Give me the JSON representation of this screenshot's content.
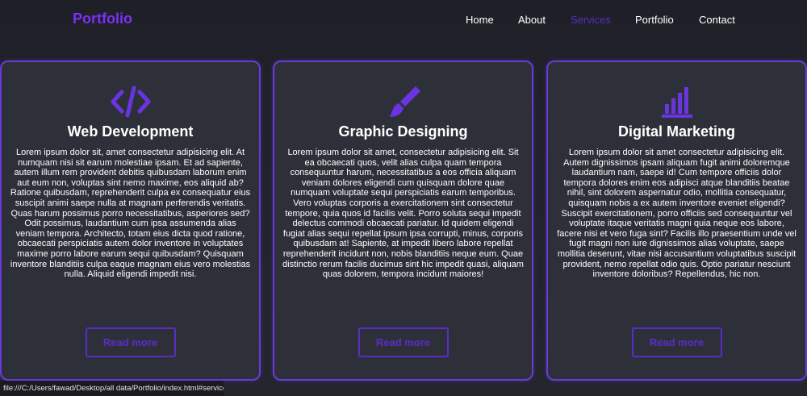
{
  "header": {
    "logo": "Portfolio",
    "nav": [
      "Home",
      "About",
      "Services",
      "Portfolio",
      "Contact"
    ],
    "active_nav": "Services"
  },
  "cards": [
    {
      "icon": "code-icon",
      "title": "Web Development",
      "text": "Lorem ipsum dolor sit, amet consectetur adipisicing elit. At numquam nisi sit earum molestiae ipsam. Et ad sapiente, autem illum rem provident debitis quibusdam laborum enim aut eum non, voluptas sint nemo maxime, eos aliquid ab? Ratione quibusdam, reprehenderit culpa ex consequatur eius suscipit animi saepe nulla at magnam perferendis veritatis. Quas harum possimus porro necessitatibus, asperiores sed? Odit possimus, laudantium cum ipsa assumenda alias veniam tempora. Architecto, totam eius dicta quod ratione, obcaecati perspiciatis autem dolor inventore in voluptates maxime porro labore earum sequi quibusdam? Quisquam inventore blanditiis culpa eaque magnam eius vero molestias nulla. Aliquid eligendi impedit nisi.",
      "button": "Read more"
    },
    {
      "icon": "paintbrush-icon",
      "title": "Graphic Designing",
      "text": "Lorem ipsum dolor sit amet, consectetur adipisicing elit. Sit ea obcaecati quos, velit alias culpa quam tempora consequuntur harum, necessitatibus a eos officia aliquam veniam dolores eligendi cum quisquam dolore quae numquam voluptate sequi perspiciatis earum temporibus. Vero voluptas corporis a exercitationem sint consectetur tempore, quia quos id facilis velit. Porro soluta sequi impedit delectus commodi obcaecati pariatur. Id quidem eligendi fugiat alias sequi repellat ipsum ipsa corrupti, minus, corporis quibusdam at! Sapiente, at impedit libero labore repellat reprehenderit incidunt non, nobis blanditiis neque eum. Quae distinctio rerum facilis ducimus sint hic impedit quasi, aliquam quas dolorem, tempora incidunt maiores!",
      "button": "Read more"
    },
    {
      "icon": "bar-chart-icon",
      "title": "Digital Marketing",
      "text": "Lorem ipsum dolor sit amet consectetur adipisicing elit. Autem dignissimos ipsam aliquam fugit animi doloremque laudantium nam, saepe id! Cum tempore officiis dolor tempora dolores enim eos adipisci atque blanditiis beatae nihil, sint dolorem aspernatur odio, mollitia consequatur, quisquam nobis a ex autem inventore eveniet eligendi? Suscipit exercitationem, porro officiis sed consequuntur vel voluptate itaque veritatis magni quia neque eos labore, facere nisi et vero fuga sint? Facilis illo praesentium unde vel fugit magni non iure dignissimos alias voluptate, saepe mollitia deserunt, vitae nisi accusantium voluptatibus suscipit provident, nemo repellat odio quis. Optio pariatur nesciunt inventore doloribus? Repellendus, hic non.",
      "button": "Read more"
    }
  ],
  "status_bar": {
    "url": "file:///C:/Users/fawad/Desktop/all data/Portfolio/index.html#services"
  },
  "colors": {
    "accent": "#7b2ff7",
    "active_link": "#5b2cc9",
    "card_border": "#6a3ad8",
    "card_bg": "#2e3039",
    "page_bg": "#22242b"
  }
}
